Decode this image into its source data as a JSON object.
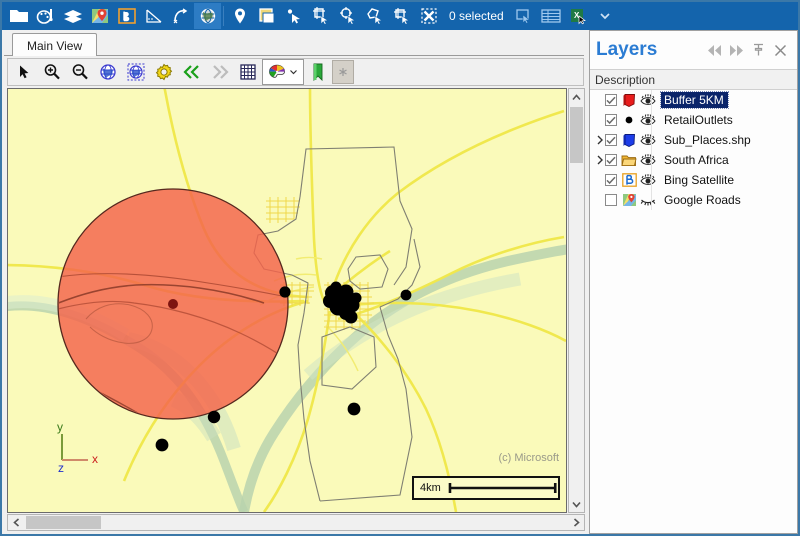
{
  "top_toolbar": {
    "icons": [
      {
        "name": "open-folder-icon",
        "label": "Open Project"
      },
      {
        "name": "symbology-palette-icon",
        "label": "Symbology"
      },
      {
        "name": "layers-stack-icon",
        "label": "Add Layer"
      },
      {
        "name": "google-maps-icon",
        "label": "Google Maps"
      },
      {
        "name": "bing-maps-icon",
        "label": "Bing Maps"
      },
      {
        "name": "measure-area-icon",
        "label": "Measure Area"
      },
      {
        "name": "measure-distance-icon",
        "label": "Measure Distance"
      },
      {
        "name": "globe-icon",
        "label": "Globe View"
      },
      {
        "name": "map-pin-icon",
        "label": "Add Point"
      },
      {
        "name": "map-window-icon",
        "label": "New Map Window"
      },
      {
        "name": "select-point-icon",
        "label": "Select Point"
      },
      {
        "name": "select-rectangle-icon",
        "label": "Select by Rectangle"
      },
      {
        "name": "select-circle-icon",
        "label": "Select by Circle"
      },
      {
        "name": "select-polygon-icon",
        "label": "Select by Polygon"
      },
      {
        "name": "select-box-icon",
        "label": "Select by Box"
      },
      {
        "name": "clear-selection-icon",
        "label": "Clear Selection"
      }
    ],
    "selection_status": "0 selected",
    "right_icons": [
      {
        "name": "zoom-to-selection-icon",
        "label": "Zoom to Selection"
      },
      {
        "name": "attribute-table-icon",
        "label": "Attribute Table"
      },
      {
        "name": "export-excel-icon",
        "label": "Export to Excel"
      },
      {
        "name": "overflow-chevron-down-icon",
        "label": "More"
      }
    ]
  },
  "tabs": [
    {
      "label": "Main View",
      "active": true
    }
  ],
  "map_toolbar": {
    "icons": [
      {
        "name": "pan-arrow-icon",
        "label": "Pan / Select"
      },
      {
        "name": "zoom-in-icon",
        "label": "Zoom In"
      },
      {
        "name": "zoom-out-icon",
        "label": "Zoom Out"
      },
      {
        "name": "zoom-full-extent-icon",
        "label": "Zoom to Full Extent"
      },
      {
        "name": "zoom-layer-extent-icon",
        "label": "Zoom to Layer"
      },
      {
        "name": "settings-gear-icon",
        "label": "Map Settings"
      },
      {
        "name": "previous-extent-icon",
        "label": "Previous Extent"
      },
      {
        "name": "next-extent-icon",
        "label": "Next Extent"
      },
      {
        "name": "grid-icon",
        "label": "Show Grid"
      },
      {
        "name": "color-palette-icon",
        "label": "Map Colors"
      },
      {
        "name": "bookmark-icon",
        "label": "Bookmarks"
      },
      {
        "name": "asterisk-disabled-icon",
        "label": "Refresh"
      }
    ]
  },
  "map": {
    "attribution": "(c) Microsoft",
    "scale_bar": {
      "label": "4km"
    },
    "axis_indicator": {
      "x": "x",
      "y": "y",
      "z": "z"
    },
    "colors": {
      "background": "#fafaba",
      "buffer_fill": "#f4634a",
      "buffer_stroke": "#4d2b22",
      "center_point": "#7d1410",
      "road": "#f2e84a",
      "river": "#cfe2c0",
      "boundary": "#8a8a7a",
      "outlet_point": "#000000"
    }
  },
  "layers_panel": {
    "title": "Layers",
    "header_buttons": [
      {
        "name": "collapse-left-icon",
        "label": "Previous"
      },
      {
        "name": "collapse-right-icon",
        "label": "Next"
      },
      {
        "name": "pin-panel-icon",
        "label": "Pin Panel"
      },
      {
        "name": "close-panel-icon",
        "label": "Close"
      }
    ],
    "column_header": "Description",
    "items": [
      {
        "label": "Buffer 5KM",
        "checked": true,
        "visible": true,
        "selected": true,
        "expandable": false,
        "icon": "red-polygon-icon"
      },
      {
        "label": "RetailOutlets",
        "checked": true,
        "visible": true,
        "selected": false,
        "expandable": false,
        "icon": "black-point-icon"
      },
      {
        "label": "Sub_Places.shp",
        "checked": true,
        "visible": true,
        "selected": false,
        "expandable": true,
        "icon": "blue-polygon-icon"
      },
      {
        "label": "South Africa",
        "checked": true,
        "visible": true,
        "selected": false,
        "expandable": true,
        "icon": "folder-group-icon"
      },
      {
        "label": "Bing Satellite",
        "checked": true,
        "visible": true,
        "selected": false,
        "expandable": false,
        "icon": "bing-maps-icon"
      },
      {
        "label": "Google Roads",
        "checked": false,
        "visible": false,
        "selected": false,
        "expandable": false,
        "icon": "google-maps-icon"
      }
    ]
  }
}
